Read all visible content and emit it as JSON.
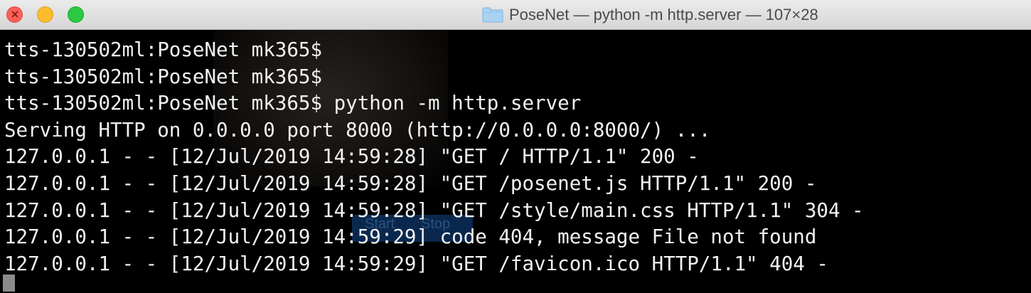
{
  "window": {
    "title": "PoseNet — python -m http.server — 107×28",
    "title_icon": "folder-icon",
    "controls": [
      "close-icon",
      "minimize-icon",
      "maximize-icon"
    ]
  },
  "terminal": {
    "background": "#000000",
    "foreground": "#f2f2f2",
    "lines": [
      "tts-130502ml:PoseNet mk365$",
      "tts-130502ml:PoseNet mk365$",
      "tts-130502ml:PoseNet mk365$ python -m http.server",
      "Serving HTTP on 0.0.0.0 port 8000 (http://0.0.0.0:8000/) ...",
      "127.0.0.1 - - [12/Jul/2019 14:59:28] \"GET / HTTP/1.1\" 200 -",
      "127.0.0.1 - - [12/Jul/2019 14:59:28] \"GET /posenet.js HTTP/1.1\" 200 -",
      "127.0.0.1 - - [12/Jul/2019 14:59:28] \"GET /style/main.css HTTP/1.1\" 304 -",
      "127.0.0.1 - - [12/Jul/2019 14:59:29] code 404, message File not found",
      "127.0.0.1 - - [12/Jul/2019 14:59:29] \"GET /favicon.ico HTTP/1.1\" 404 -"
    ],
    "background_ghost": {
      "start_label": "Start",
      "stop_label": "Stop"
    }
  }
}
